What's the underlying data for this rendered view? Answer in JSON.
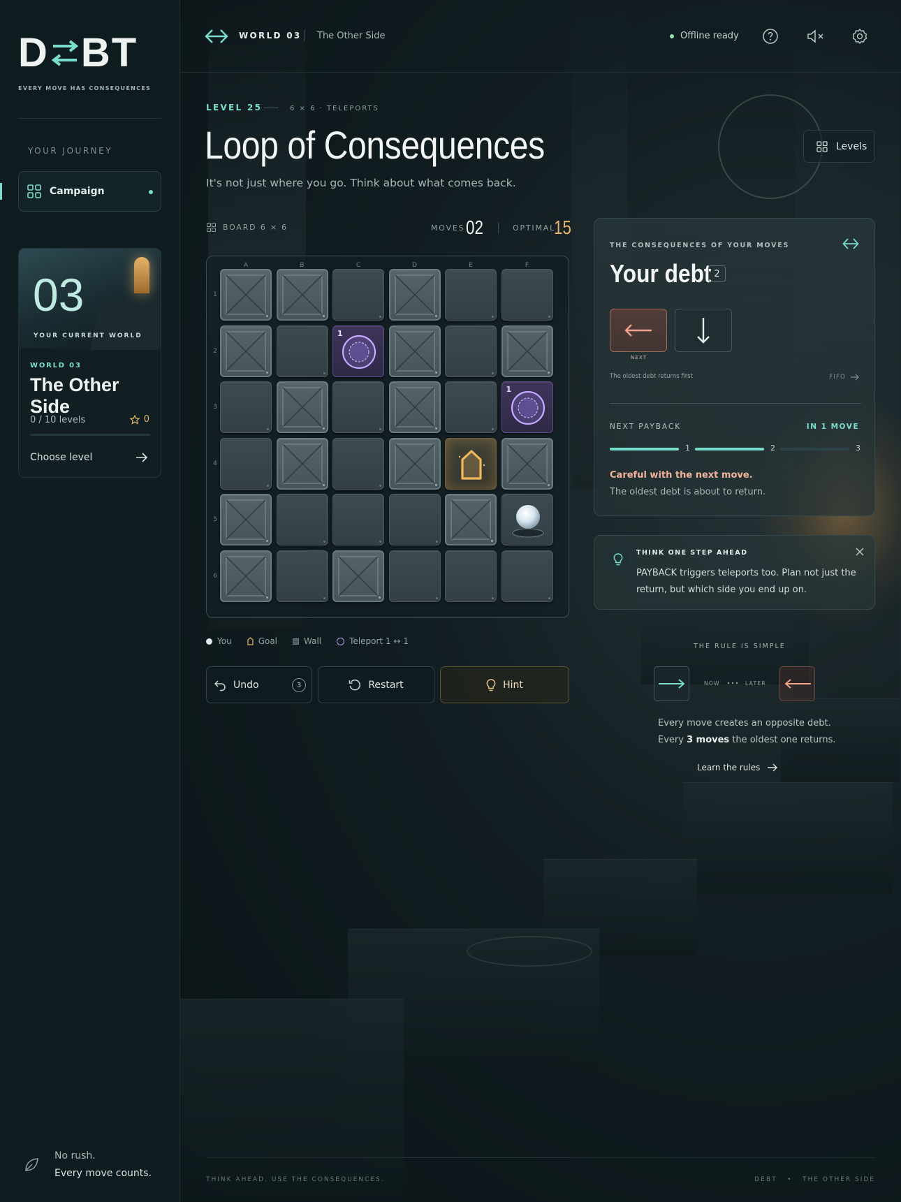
{
  "brand": {
    "logo_left": "D",
    "logo_right": "BT",
    "tagline": "EVERY MOVE HAS CONSEQUENCES"
  },
  "sidebar": {
    "section": "YOUR JOURNEY",
    "nav": [
      {
        "label": "Campaign",
        "icon": "grid-icon",
        "active": true
      }
    ],
    "world_card": {
      "number": "03",
      "current_label": "YOUR CURRENT WORLD",
      "world_tag": "WORLD 03",
      "world_name": "The Other Side",
      "progress": "0 / 10 levels",
      "progress_fraction": 0,
      "stars": "0",
      "choose": "Choose level"
    },
    "footer": {
      "line1": "No rush.",
      "line2": "Every move counts."
    }
  },
  "topbar": {
    "world": "WORLD 03",
    "world_name": "The Other Side",
    "status": "Offline ready",
    "status_color": "#8fe3b0"
  },
  "level": {
    "tag": "LEVEL 25",
    "meta": "6 × 6 · TELEPORTS",
    "title": "Loop of Consequences",
    "subtitle": "It's not just where you go. Think about what comes back.",
    "levels_button": "Levels"
  },
  "board_info": {
    "label": "BOARD 6 × 6",
    "moves_label": "MOVES",
    "moves": "02",
    "optimal_label": "OPTIMAL",
    "optimal": "15"
  },
  "board": {
    "columns": [
      "A",
      "B",
      "C",
      "D",
      "E",
      "F"
    ],
    "rows": [
      "1",
      "2",
      "3",
      "4",
      "5",
      "6"
    ],
    "cells": [
      [
        "wall",
        "wall",
        "floor",
        "wall",
        "floor",
        "floor"
      ],
      [
        "wall",
        "floor",
        "teleport",
        "wall",
        "floor",
        "wall"
      ],
      [
        "floor",
        "wall",
        "floor",
        "wall",
        "floor",
        "teleport"
      ],
      [
        "floor",
        "wall",
        "floor",
        "wall",
        "goal",
        "wall"
      ],
      [
        "wall",
        "floor",
        "floor",
        "floor",
        "wall",
        "player"
      ],
      [
        "wall",
        "floor",
        "wall",
        "floor",
        "floor",
        "floor"
      ]
    ],
    "teleport_label": "1"
  },
  "legend": {
    "you": "You",
    "goal": "Goal",
    "wall": "Wall",
    "teleport": "Teleport 1 ↔ 1"
  },
  "controls": {
    "undo": "Undo",
    "undo_count": "3",
    "restart": "Restart",
    "hint": "Hint"
  },
  "debt": {
    "caption": "THE CONSEQUENCES OF YOUR MOVES",
    "title": "Your debt",
    "count": "2",
    "queue": [
      "arrow-left",
      "arrow-down"
    ],
    "next_label": "NEXT",
    "oldest_note": "The oldest debt returns first",
    "fifo": "FIFO",
    "payback_label": "NEXT PAYBACK",
    "payback_when": "IN 1 MOVE",
    "payback_steps": [
      "1",
      "2",
      "3"
    ],
    "payback_filled": 2,
    "warning": "Careful with the next move.",
    "warning_detail": "The oldest debt is about to return."
  },
  "tip": {
    "caption": "THINK ONE STEP AHEAD",
    "body": "PAYBACK triggers teleports too. Plan not just the return, but which side you end up on."
  },
  "rule": {
    "caption": "THE RULE IS SIMPLE",
    "now": "NOW",
    "later": "LATER",
    "line1": "Every move creates an opposite debt.",
    "line2_pre": "Every ",
    "line2_bold": "3 moves",
    "line2_post": " the oldest one returns.",
    "learn": "Learn the rules"
  },
  "footer": {
    "left": "THINK AHEAD. USE THE CONSEQUENCES.",
    "right": "DEBT   •   THE OTHER SIDE"
  },
  "colors": {
    "accent": "#79dccd",
    "gold": "#e5b56a",
    "debt_red": "#f2a38c",
    "teleport": "#b89cf5"
  }
}
